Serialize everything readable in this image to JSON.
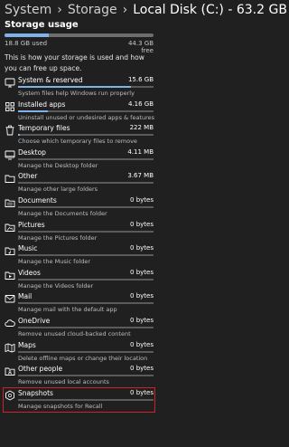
{
  "breadcrumb": {
    "items": [
      "System",
      "Storage",
      "Local Disk (C:) - 63.2 GB"
    ],
    "separator": "›"
  },
  "section_title": "Storage usage",
  "summary": {
    "used": "18.8 GB used",
    "free": "44.3 GB free",
    "used_fraction": 0.297
  },
  "description": "This is how your storage is used and how you can free up space.",
  "colors": {
    "background": "#202020",
    "accent": "#7fb2e6",
    "highlight_border": "#d0202a"
  },
  "categories": [
    {
      "icon": "monitor-icon",
      "name": "System & reserved",
      "size": "15.6 GB",
      "desc": "System files help Windows run properly",
      "fill": 0.83
    },
    {
      "icon": "apps-grid-icon",
      "name": "Installed apps",
      "size": "4.16 GB",
      "desc": "Uninstall unused or undesired apps & features",
      "fill": 0.22
    },
    {
      "icon": "trash-icon",
      "name": "Temporary files",
      "size": "222 MB",
      "desc": "Choose which temporary files to remove",
      "fill": 0.012
    },
    {
      "icon": "desktop-icon",
      "name": "Desktop",
      "size": "4.11 MB",
      "desc": "Manage the Desktop folder",
      "fill": 0
    },
    {
      "icon": "folder-icon",
      "name": "Other",
      "size": "3.67 MB",
      "desc": "Manage other large folders",
      "fill": 0
    },
    {
      "icon": "documents-icon",
      "name": "Documents",
      "size": "0 bytes",
      "desc": "Manage the Documents folder",
      "fill": 0
    },
    {
      "icon": "pictures-icon",
      "name": "Pictures",
      "size": "0 bytes",
      "desc": "Manage the Pictures folder",
      "fill": 0
    },
    {
      "icon": "music-icon",
      "name": "Music",
      "size": "0 bytes",
      "desc": "Manage the Music folder",
      "fill": 0
    },
    {
      "icon": "videos-icon",
      "name": "Videos",
      "size": "0 bytes",
      "desc": "Manage the Videos folder",
      "fill": 0
    },
    {
      "icon": "mail-icon",
      "name": "Mail",
      "size": "0 bytes",
      "desc": "Manage mail with the default app",
      "fill": 0
    },
    {
      "icon": "cloud-icon",
      "name": "OneDrive",
      "size": "0 bytes",
      "desc": "Remove unused cloud-backed content",
      "fill": 0
    },
    {
      "icon": "map-icon",
      "name": "Maps",
      "size": "0 bytes",
      "desc": "Delete offline maps or change their location",
      "fill": 0
    },
    {
      "icon": "people-icon",
      "name": "Other people",
      "size": "0 bytes",
      "desc": "Remove unused local accounts",
      "fill": 0
    },
    {
      "icon": "snapshot-icon",
      "name": "Snapshots",
      "size": "0 bytes",
      "desc": "Manage snapshots for Recall",
      "fill": 0
    }
  ]
}
